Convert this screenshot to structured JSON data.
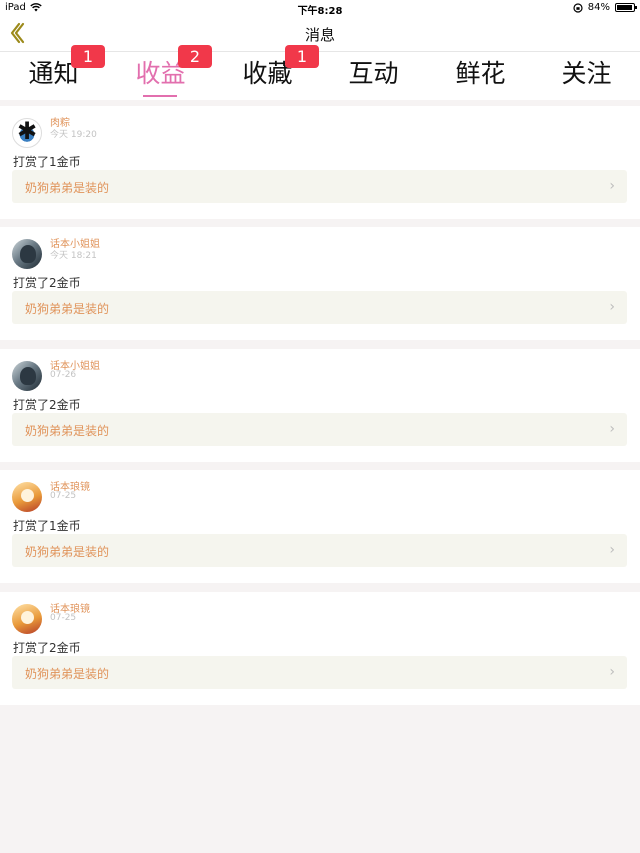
{
  "status_bar": {
    "device": "iPad",
    "time": "下午8:28",
    "battery": "84%",
    "battery_level": 0.84
  },
  "header": {
    "title": "消息"
  },
  "tabs": [
    {
      "label": "通知",
      "badge": "1",
      "active": false
    },
    {
      "label": "收益",
      "badge": "2",
      "active": true
    },
    {
      "label": "收藏",
      "badge": "1",
      "active": false
    },
    {
      "label": "互动",
      "badge": "",
      "active": false
    },
    {
      "label": "鲜花",
      "badge": "",
      "active": false
    },
    {
      "label": "关注",
      "badge": "",
      "active": false
    }
  ],
  "notifications": [
    {
      "username": "肉粽",
      "time": "今天 19:20",
      "action": "打赏了1金币",
      "title": "奶狗弟弟是装的"
    },
    {
      "username": "话本小姐姐",
      "time": "今天 18:21",
      "action": "打赏了2金币",
      "title": "奶狗弟弟是装的"
    },
    {
      "username": "话本小姐姐",
      "time": "07-26",
      "action": "打赏了2金币",
      "title": "奶狗弟弟是装的"
    },
    {
      "username": "话本琅镜",
      "time": "07-25",
      "action": "打赏了1金币",
      "title": "奶狗弟弟是装的"
    },
    {
      "username": "话本琅镜",
      "time": "07-25",
      "action": "打赏了2金币",
      "title": "奶狗弟弟是装的"
    }
  ],
  "icons": {
    "chevron": "›",
    "back": "back-chevron-icon",
    "wifi": "wifi-icon",
    "battery": "battery-icon",
    "lock": "rotation-lock-icon"
  },
  "colors": {
    "accent": "#e26fae",
    "badge": "#f1384a",
    "username": "#e0935a",
    "back_arrow": "#9c8a1a"
  }
}
